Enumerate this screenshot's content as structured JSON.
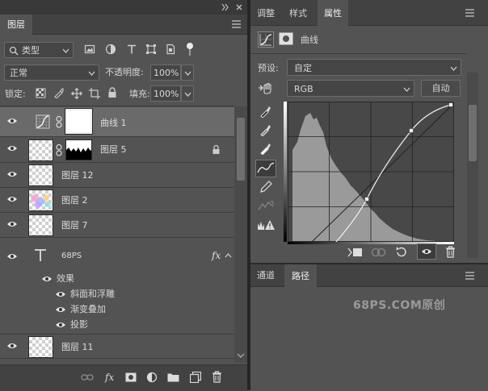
{
  "left_panel": {
    "tab_title": "图层",
    "filter_select": "类型",
    "blend_mode": "正常",
    "opacity_label": "不透明度:",
    "opacity_value": "100%",
    "lock_label": "锁定:",
    "fill_label": "填充:",
    "fill_value": "100%",
    "layers": [
      {
        "name": "曲线 1",
        "type": "adjustment-curves",
        "selected": true
      },
      {
        "name": "图层 5",
        "type": "masked",
        "locked": true
      },
      {
        "name": "图层 12",
        "type": "pixel"
      },
      {
        "name": "图层 2",
        "type": "pixel-color"
      },
      {
        "name": "图层 7",
        "type": "pixel"
      },
      {
        "name": "68PS",
        "type": "text",
        "fx": "fx"
      },
      {
        "name": "图层 11",
        "type": "pixel"
      }
    ],
    "effects": {
      "title": "效果",
      "items": [
        "斜面和浮雕",
        "渐变叠加",
        "投影"
      ]
    }
  },
  "right_panel": {
    "tabs": [
      "调整",
      "样式",
      "属性"
    ],
    "active_tab": "属性",
    "panel_title": "曲线",
    "preset_label": "预设:",
    "preset_value": "自定",
    "channel_value": "RGB",
    "auto_button": "自动",
    "bottom_tabs": [
      "通道",
      "路径"
    ],
    "active_bottom_tab": "路径",
    "watermark": "68PS.COM原创"
  },
  "colors": {
    "panel_bg": "#535353",
    "tabbar_bg": "#424242",
    "selected_row": "#6a6a6a",
    "divider": "#262626"
  }
}
